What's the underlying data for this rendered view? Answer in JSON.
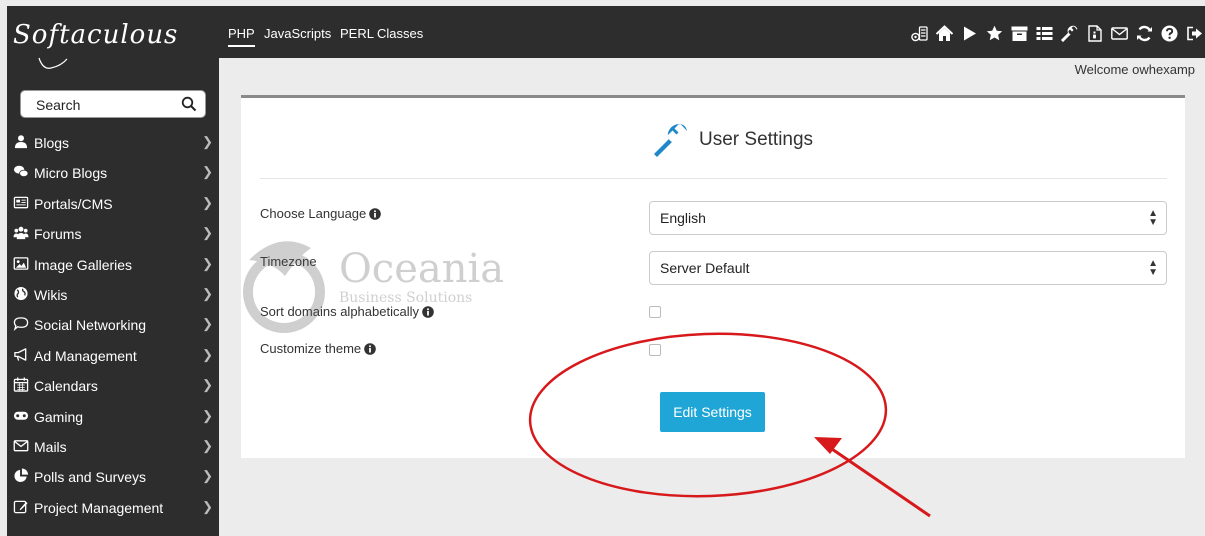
{
  "app": {
    "logo_text": "Softaculous"
  },
  "search": {
    "placeholder": "Search"
  },
  "sidebar": {
    "items": [
      {
        "label": "Blogs",
        "icon": "user-icon"
      },
      {
        "label": "Micro Blogs",
        "icon": "chat-bubbles-icon"
      },
      {
        "label": "Portals/CMS",
        "icon": "newspaper-icon"
      },
      {
        "label": "Forums",
        "icon": "users-icon"
      },
      {
        "label": "Image Galleries",
        "icon": "image-icon"
      },
      {
        "label": "Wikis",
        "icon": "globe-icon"
      },
      {
        "label": "Social Networking",
        "icon": "speech-icon"
      },
      {
        "label": "Ad Management",
        "icon": "megaphone-icon"
      },
      {
        "label": "Calendars",
        "icon": "calendar-icon"
      },
      {
        "label": "Gaming",
        "icon": "gamepad-icon"
      },
      {
        "label": "Mails",
        "icon": "envelope-icon"
      },
      {
        "label": "Polls and Surveys",
        "icon": "pie-chart-icon"
      },
      {
        "label": "Project Management",
        "icon": "edit-icon"
      }
    ]
  },
  "topbar": {
    "tabs": [
      {
        "label": "PHP",
        "active": true
      },
      {
        "label": "JavaScripts"
      },
      {
        "label": "PERL"
      },
      {
        "label": "Classes"
      }
    ],
    "toolbar_icons": [
      "installations-icon",
      "home-icon",
      "play-icon",
      "star-icon",
      "archive-icon",
      "list-icon",
      "wrench-icon",
      "file-icon",
      "envelope-icon",
      "refresh-icon",
      "help-icon",
      "logout-icon"
    ]
  },
  "welcome": "Welcome owhexamp",
  "panel": {
    "title": "User Settings",
    "language": {
      "label": "Choose Language",
      "value": "English"
    },
    "timezone": {
      "label": "Timezone",
      "value": "Server Default"
    },
    "sort_domains": {
      "label": "Sort domains alphabetically",
      "checked": false
    },
    "customize_theme": {
      "label": "Customize theme",
      "checked": false
    },
    "submit_label": "Edit Settings"
  },
  "watermark": {
    "name": "Oceania",
    "tagline": "Business Solutions"
  },
  "colors": {
    "sidebar_bg": "#2d2d2d",
    "button": "#1fa6d6",
    "annotation": "#d7191c",
    "wrench": "#1e88c8"
  }
}
